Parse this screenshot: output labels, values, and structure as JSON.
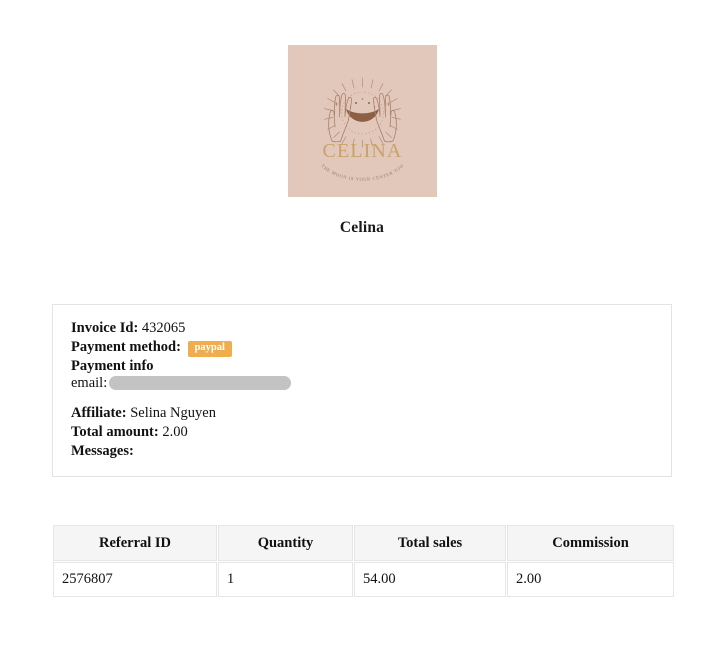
{
  "brand": {
    "name": "Celina",
    "logo": {
      "icon": "celina-moon-hands-logo",
      "wordmark": "CELINA",
      "tagline": "THE MOON IS YOUR CENTER TOO",
      "background_color": "#e2c8bb",
      "line_color": "#a9806a",
      "wordmark_color": "#c9a16a"
    }
  },
  "invoice": {
    "invoice_id_label": "Invoice Id:",
    "invoice_id_value": "432065",
    "payment_method_label": "Payment method:",
    "payment_method_value": "paypal",
    "payment_method_badge_color": "#f0ad4e",
    "payment_info_label": "Payment info",
    "email_label": "email:",
    "email_value": "",
    "email_redacted": true,
    "affiliate_label": "Affiliate:",
    "affiliate_value": "Selina Nguyen",
    "total_amount_label": "Total amount:",
    "total_amount_value": "2.00",
    "messages_label": "Messages:",
    "messages_value": ""
  },
  "referrals": {
    "columns": [
      "Referral ID",
      "Quantity",
      "Total sales",
      "Commission"
    ],
    "rows": [
      {
        "referral_id": "2576807",
        "quantity": "1",
        "total_sales": "54.00",
        "commission": "2.00"
      }
    ]
  }
}
